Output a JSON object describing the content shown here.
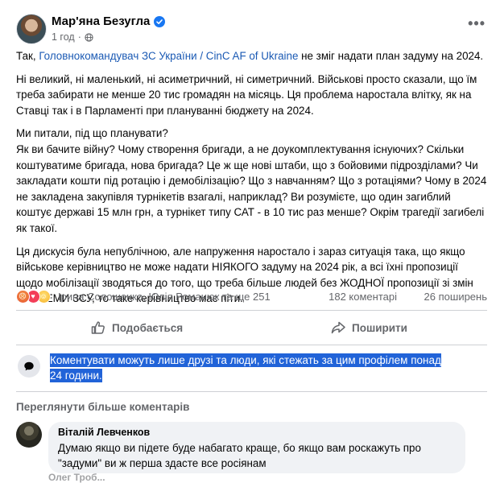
{
  "post": {
    "author": "Мар'яна Безугла",
    "timestamp": "1 год",
    "separator": "·",
    "more_glyph": "•••",
    "paragraph1": {
      "prefix": "Так, ",
      "link1": "Головнокомандувач ЗС України",
      "slash": " / ",
      "link2": "CinC AF of Ukraine",
      "suffix": " не зміг надати план задуму на 2024."
    },
    "paragraph2": "Ні великий, ні маленький, ні асиметричний, ні симетричний. Військові просто сказали, що їм треба забирати не менше 20 тис громадян на місяць. Ця проблема наростала влітку, як на Ставці так і в Парламенті при плануванні бюджету на 2024.",
    "paragraph3_line1": "Ми питали, під що планувати?",
    "paragraph3_rest": "Як ви бачите війну? Чому створення бригади, а не доукомплектування існуючих? Скільки коштуватиме бригада, нова бригада? Це ж ще нові штаби, що з бойовими підрозділами? Чи закладати кошти під ротацію і демобілізацію? Що з навчанням? Що з ротаціями? Чому в 2024 не закладена закупівля турнікетів взагалі, наприклад? Ви розумієте, що один загиблий коштує державі 15 млн грн, а турнікет типу САТ - в 10 тис раз менше? Окрім трагедії загибелі як такої.",
    "paragraph4": "Ця дискусія була непублічною, але напруження наростало і зараз ситуація така, що якщо військове керівництво не може надати НІЯКОГО задуму на 2024 рік, а всі їхні пропозиції щодо мобілізації зводяться до того, що треба більше людей без ЖОДНОЇ пропозиції зі змін СИСТЕМИ ЗСУ, то таке керівництво має піти."
  },
  "stats": {
    "reacted_names": "Ірина Солошенко, Юлія Романюк та ще 251",
    "comments": "182 коментарі",
    "shares": "26 поширень",
    "reaction_icons": [
      "angry-icon",
      "love-icon",
      "wow-icon"
    ]
  },
  "actions": {
    "like_label": "Подобається",
    "share_label": "Поширити"
  },
  "notice": {
    "text": "Коментувати можуть лише друзі та люди, які стежать за цим профілем понад 24 години."
  },
  "comments_section": {
    "more_label": "Переглянути більше коментарів",
    "comment": {
      "author": "Віталій Левченков",
      "text": "Думаю якщо ви підете буде набагато краще, бо якщо вам роскажуть про \"задуми\" ви ж перша здасте все росіянам"
    },
    "next_author_partial": "Олег Троб..."
  },
  "colors": {
    "link": "#1b5ab4",
    "selection_highlight": "#2163d8",
    "secondary_text": "#65676b",
    "comment_bubble": "#f0f2f5"
  }
}
